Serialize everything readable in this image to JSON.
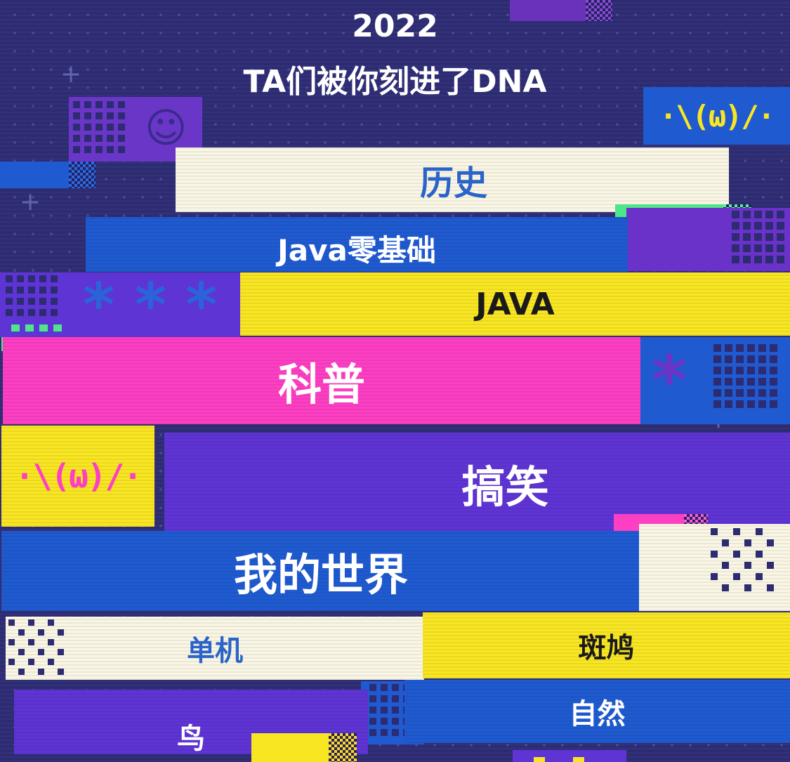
{
  "header": {
    "year": "2022",
    "subtitle": "TA们被你刻进了DNA"
  },
  "tags": [
    {
      "label": "历史"
    },
    {
      "label": "Java零基础"
    },
    {
      "label": "JAVA"
    },
    {
      "label": "科普"
    },
    {
      "label": "搞笑"
    },
    {
      "label": "我的世界"
    },
    {
      "label": "单机"
    },
    {
      "label": "斑鸠"
    },
    {
      "label": "鸟"
    },
    {
      "label": "自然"
    }
  ],
  "decor": {
    "kaomoji": "·\\(ω)/·",
    "smiley_icon": "☺",
    "asterisk": "*"
  },
  "colors": {
    "background": "#2d2b72",
    "cream": "#faf6e6",
    "blue": "#1f5ad0",
    "yellow": "#f9e623",
    "pink": "#fd3fc3",
    "purple": "#5f34d4",
    "green": "#4fe68a",
    "text_blue": "#2a64c8",
    "text_dark": "#1a1a1a",
    "text_white": "#ffffff"
  }
}
